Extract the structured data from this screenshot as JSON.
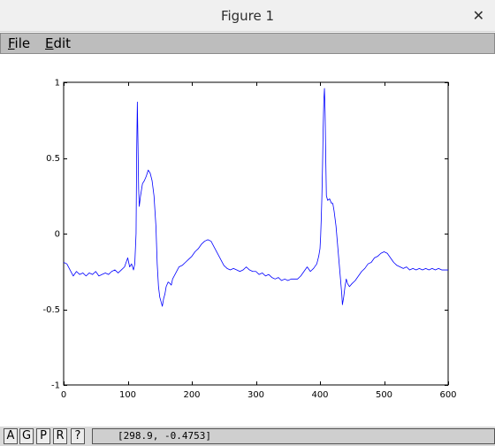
{
  "window": {
    "title": "Figure 1",
    "close_glyph": "✕"
  },
  "menu": {
    "file": {
      "accel": "F",
      "rest": "ile"
    },
    "edit": {
      "accel": "E",
      "rest": "dit"
    }
  },
  "toolbar": {
    "buttons": [
      "A",
      "G",
      "P",
      "R",
      "?"
    ]
  },
  "status": {
    "coordinates": "[298.9, -0.4753]"
  },
  "colors": {
    "trace": "#0000ff",
    "axes": "#000000"
  },
  "chart_data": {
    "type": "line",
    "title": "",
    "xlabel": "",
    "ylabel": "",
    "xlim": [
      0,
      600
    ],
    "ylim": [
      -1,
      1
    ],
    "xticks": [
      0,
      100,
      200,
      300,
      400,
      500,
      600
    ],
    "yticks": [
      -1,
      -0.5,
      0,
      0.5,
      1
    ],
    "xtick_labels": [
      "0",
      "100",
      "200",
      "300",
      "400",
      "500",
      "600"
    ],
    "ytick_labels": [
      "-1",
      "-0.5",
      "0",
      "0.5",
      "1"
    ],
    "grid": false,
    "series": [
      {
        "name": "",
        "color": "#0000ff",
        "points": [
          [
            0,
            -0.19
          ],
          [
            5,
            -0.2
          ],
          [
            10,
            -0.24
          ],
          [
            15,
            -0.28
          ],
          [
            20,
            -0.25
          ],
          [
            25,
            -0.27
          ],
          [
            30,
            -0.26
          ],
          [
            35,
            -0.28
          ],
          [
            40,
            -0.26
          ],
          [
            45,
            -0.27
          ],
          [
            50,
            -0.25
          ],
          [
            55,
            -0.28
          ],
          [
            60,
            -0.27
          ],
          [
            65,
            -0.26
          ],
          [
            70,
            -0.27
          ],
          [
            75,
            -0.25
          ],
          [
            80,
            -0.24
          ],
          [
            85,
            -0.26
          ],
          [
            90,
            -0.24
          ],
          [
            95,
            -0.22
          ],
          [
            100,
            -0.16
          ],
          [
            103,
            -0.22
          ],
          [
            106,
            -0.2
          ],
          [
            109,
            -0.24
          ],
          [
            111,
            -0.2
          ],
          [
            113,
            0.0
          ],
          [
            114,
            0.55
          ],
          [
            115,
            0.87
          ],
          [
            116,
            0.6
          ],
          [
            117,
            0.3
          ],
          [
            118,
            0.18
          ],
          [
            120,
            0.25
          ],
          [
            123,
            0.33
          ],
          [
            126,
            0.35
          ],
          [
            129,
            0.38
          ],
          [
            132,
            0.42
          ],
          [
            135,
            0.4
          ],
          [
            138,
            0.35
          ],
          [
            141,
            0.25
          ],
          [
            144,
            0.05
          ],
          [
            146,
            -0.2
          ],
          [
            148,
            -0.35
          ],
          [
            150,
            -0.42
          ],
          [
            152,
            -0.45
          ],
          [
            154,
            -0.48
          ],
          [
            156,
            -0.43
          ],
          [
            158,
            -0.4
          ],
          [
            160,
            -0.35
          ],
          [
            163,
            -0.32
          ],
          [
            166,
            -0.33
          ],
          [
            168,
            -0.34
          ],
          [
            170,
            -0.3
          ],
          [
            175,
            -0.26
          ],
          [
            180,
            -0.22
          ],
          [
            185,
            -0.21
          ],
          [
            190,
            -0.19
          ],
          [
            195,
            -0.17
          ],
          [
            200,
            -0.15
          ],
          [
            205,
            -0.12
          ],
          [
            210,
            -0.1
          ],
          [
            215,
            -0.07
          ],
          [
            220,
            -0.05
          ],
          [
            225,
            -0.04
          ],
          [
            230,
            -0.05
          ],
          [
            235,
            -0.09
          ],
          [
            240,
            -0.13
          ],
          [
            245,
            -0.17
          ],
          [
            250,
            -0.21
          ],
          [
            255,
            -0.23
          ],
          [
            260,
            -0.24
          ],
          [
            265,
            -0.23
          ],
          [
            270,
            -0.24
          ],
          [
            275,
            -0.25
          ],
          [
            280,
            -0.24
          ],
          [
            285,
            -0.22
          ],
          [
            290,
            -0.24
          ],
          [
            295,
            -0.25
          ],
          [
            300,
            -0.25
          ],
          [
            305,
            -0.27
          ],
          [
            310,
            -0.26
          ],
          [
            315,
            -0.28
          ],
          [
            320,
            -0.27
          ],
          [
            325,
            -0.29
          ],
          [
            330,
            -0.3
          ],
          [
            335,
            -0.29
          ],
          [
            340,
            -0.31
          ],
          [
            345,
            -0.3
          ],
          [
            350,
            -0.31
          ],
          [
            355,
            -0.3
          ],
          [
            360,
            -0.3
          ],
          [
            365,
            -0.3
          ],
          [
            370,
            -0.28
          ],
          [
            375,
            -0.25
          ],
          [
            380,
            -0.22
          ],
          [
            385,
            -0.25
          ],
          [
            390,
            -0.23
          ],
          [
            395,
            -0.2
          ],
          [
            398,
            -0.15
          ],
          [
            400,
            -0.1
          ],
          [
            401,
            -0.02
          ],
          [
            402,
            0.1
          ],
          [
            403,
            0.25
          ],
          [
            404,
            0.45
          ],
          [
            405,
            0.7
          ],
          [
            406,
            0.88
          ],
          [
            407,
            0.96
          ],
          [
            408,
            0.8
          ],
          [
            409,
            0.5
          ],
          [
            410,
            0.25
          ],
          [
            412,
            0.22
          ],
          [
            415,
            0.23
          ],
          [
            418,
            0.2
          ],
          [
            420,
            0.2
          ],
          [
            422,
            0.15
          ],
          [
            425,
            0.05
          ],
          [
            428,
            -0.1
          ],
          [
            430,
            -0.2
          ],
          [
            432,
            -0.3
          ],
          [
            434,
            -0.4
          ],
          [
            435,
            -0.47
          ],
          [
            437,
            -0.42
          ],
          [
            439,
            -0.35
          ],
          [
            441,
            -0.3
          ],
          [
            443,
            -0.33
          ],
          [
            446,
            -0.35
          ],
          [
            450,
            -0.33
          ],
          [
            455,
            -0.31
          ],
          [
            460,
            -0.28
          ],
          [
            465,
            -0.25
          ],
          [
            470,
            -0.23
          ],
          [
            475,
            -0.2
          ],
          [
            480,
            -0.19
          ],
          [
            485,
            -0.16
          ],
          [
            490,
            -0.15
          ],
          [
            495,
            -0.13
          ],
          [
            500,
            -0.12
          ],
          [
            505,
            -0.13
          ],
          [
            510,
            -0.16
          ],
          [
            515,
            -0.19
          ],
          [
            520,
            -0.21
          ],
          [
            525,
            -0.22
          ],
          [
            530,
            -0.23
          ],
          [
            535,
            -0.22
          ],
          [
            540,
            -0.24
          ],
          [
            545,
            -0.23
          ],
          [
            550,
            -0.24
          ],
          [
            555,
            -0.23
          ],
          [
            560,
            -0.24
          ],
          [
            565,
            -0.23
          ],
          [
            570,
            -0.24
          ],
          [
            575,
            -0.23
          ],
          [
            580,
            -0.24
          ],
          [
            585,
            -0.23
          ],
          [
            590,
            -0.24
          ],
          [
            595,
            -0.24
          ],
          [
            600,
            -0.24
          ]
        ]
      }
    ]
  }
}
